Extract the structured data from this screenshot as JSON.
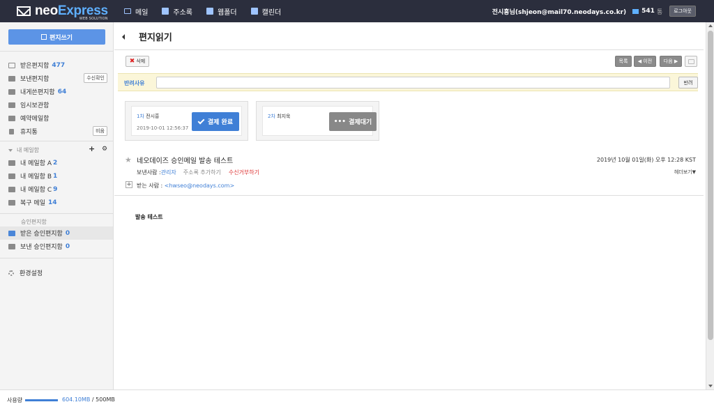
{
  "app": {
    "logo_main": "neo",
    "logo_accent": "Express",
    "logo_sub": "WEB SOLUTION"
  },
  "topnav": [
    {
      "label": "메일",
      "icon": "mail-icon"
    },
    {
      "label": "주소록",
      "icon": "address-book-icon"
    },
    {
      "label": "웹폴더",
      "icon": "webfolder-icon"
    },
    {
      "label": "캘린더",
      "icon": "calendar-icon"
    }
  ],
  "user": {
    "name": "전시흥님(shjeon@mail70.neodays.co.kr)",
    "mail_count": "541",
    "mail_unit": "통",
    "logout_label": "로그아웃"
  },
  "sidebar": {
    "compose_label": "편지쓰기",
    "folders": [
      {
        "label": "받은편지함",
        "count": "477"
      },
      {
        "label": "보낸편지함",
        "count": "",
        "button": "수신확인"
      },
      {
        "label": "내게쓴편지함",
        "count": "64"
      },
      {
        "label": "임시보관함",
        "count": ""
      },
      {
        "label": "예약메일함",
        "count": ""
      },
      {
        "label": "휴지통",
        "count": "",
        "button": "비움"
      }
    ],
    "my_mailbox_title": "내 메일함",
    "my_mailbox_plus": "+",
    "my_mailbox_gear": "⚙",
    "my_folders": [
      {
        "label": "내 메일함 A",
        "count": "2"
      },
      {
        "label": "내 메일함 B",
        "count": "1"
      },
      {
        "label": "내 메일함 C",
        "count": "9"
      },
      {
        "label": "복구 메일",
        "count": "14"
      }
    ],
    "approval_title": "승인편지함",
    "approval_folders": [
      {
        "label": "받은 승인편지함",
        "count": "0"
      },
      {
        "label": "보낸 승인편지함",
        "count": "0"
      }
    ],
    "settings_label": "환경설정"
  },
  "main": {
    "page_title": "편지읽기",
    "delete_label": "삭제",
    "delete_icon": "✖",
    "list_label": "목록",
    "prev_label": "◀ 이전",
    "next_label": "다음 ▶",
    "reject_label": "반려사유",
    "reject_button": "반려",
    "approvals": [
      {
        "step": "1차",
        "name": "전시흥",
        "date": "2019-10-01 12:56:37",
        "button": "결제 완료",
        "state": "done"
      },
      {
        "step": "2차",
        "name": "최지욱",
        "date": "",
        "button": "결제대기",
        "state": "wait",
        "icon": "•••"
      }
    ],
    "star_icon": "★",
    "subject": "네오데이즈 승인메일 발송 테스트",
    "date": "2019년 10월 01일(화) 오후 12:28 KST",
    "sender_label": "보낸사람 : ",
    "sender_name": "관리자",
    "add_contact": "주소록 추가하기",
    "block_sender": "수신거부하기",
    "header_view": "헤더보기▼",
    "expand_icon": "+",
    "to_label": "받는 사람 : ",
    "to_addr": "<hwseo@neodays.com>",
    "body": "발송 테스트"
  },
  "footer": {
    "usage_label": "사용량",
    "used": "604.10MB",
    "total": " / 500MB",
    "usage_fraction": 1.0
  },
  "colors": {
    "topbar": "#2b2e3d",
    "accent": "#3f7fd6",
    "compose": "#5c94e6",
    "reject_bar": "#fbf6d9"
  }
}
